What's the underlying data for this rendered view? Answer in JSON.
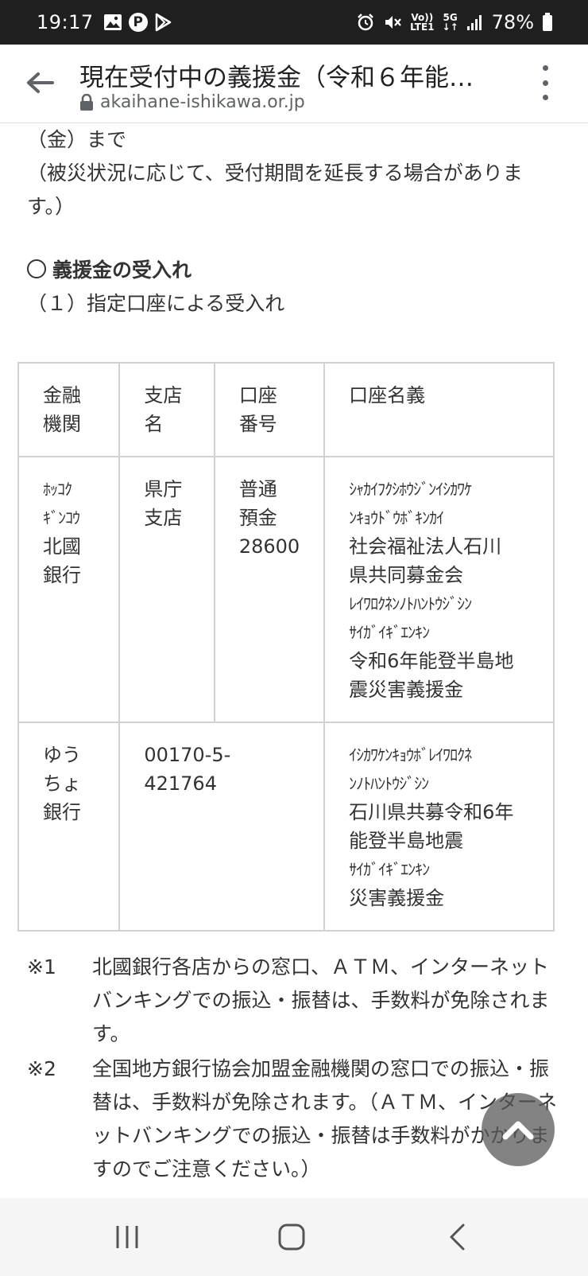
{
  "status_bar": {
    "time": "19:17",
    "battery": "78%",
    "network_top": "5G",
    "lte_top": "Vo))",
    "lte_bottom": "LTE1",
    "left_icons": [
      "image-icon",
      "p-badge-icon",
      "play-store-icon"
    ],
    "right_icons": [
      "alarm-icon",
      "mute-icon",
      "volte-icon",
      "5g-icon",
      "signal-icon",
      "battery-icon"
    ]
  },
  "toolbar": {
    "title": "現在受付中の義援金（令和６年能…",
    "url": "akaihane-ishikawa.or.jp"
  },
  "content": {
    "line1": "（金）まで",
    "line2": "（被災状況に応じて、受付期間を延長する場合がありま",
    "line3": "す。）",
    "section_heading": "義援金の受入れ",
    "sub_heading": "（１）指定口座による受入れ"
  },
  "table": {
    "headers": [
      "金融\n機関",
      "支店\n名",
      "口座\n番号",
      "口座名義"
    ],
    "row1": {
      "bank_kana": "ﾎｯｺｸ\nｷﾞﾝｺｳ",
      "bank": "北國\n銀行",
      "branch": "県庁\n支店",
      "account": "普通\n預金\n28600",
      "holder_kana1": "ｼｬｶｲﾌｸｼﾎｳｼﾞﾝｲｼｶﾜｹ\nﾝｷｮｳﾄﾞｳﾎﾞｷﾝｶｲ",
      "holder1": "社会福祉法人石川\n県共同募金会",
      "holder_kana2": "ﾚｲﾜﾛｸﾈﾝﾉﾄﾊﾝﾄｳｼﾞｼﾝ\nｻｲｶﾞｲｷﾞｴﾝｷﾝ",
      "holder2": "令和6年能登半島地\n震災害義援金"
    },
    "row2": {
      "bank": "ゆう\nちょ\n銀行",
      "account": "00170-5-421764",
      "holder_kana1": "ｲｼｶﾜｹﾝｷｮｳﾎﾞﾚｲﾜﾛｸﾈ\nﾝﾉﾄﾊﾝﾄｳｼﾞｼﾝ",
      "holder1": "石川県共募令和6年\n能登半島地震",
      "holder_kana2": "ｻｲｶﾞｲｷﾞｴﾝｷﾝ",
      "holder2": "災害義援金"
    }
  },
  "notes": [
    {
      "mark": "※1",
      "text": "北國銀行各店からの窓口、ＡＴＭ、インターネットバンキングでの振込・振替は、手数料が免除されます。"
    },
    {
      "mark": "※2",
      "text": "全国地方銀行協会加盟金融機関の窓口での振込・振替は、手数料が免除されます。（ＡＴＭ、インターネットバンキングでの振込・振替は手数料がかかりますのでご注意ください。）"
    }
  ],
  "colors": {
    "status_bar_bg": "#1f1f1f",
    "table_border": "#d2d2d2",
    "nav_bg": "#f5f5f5"
  }
}
